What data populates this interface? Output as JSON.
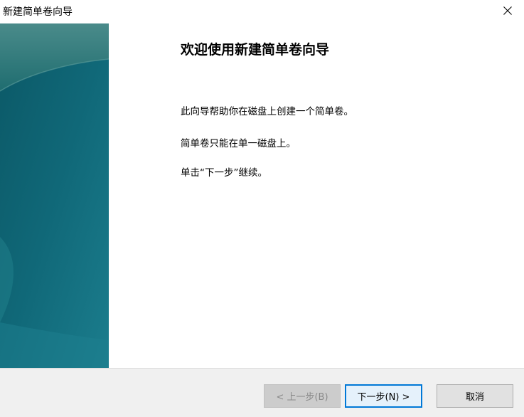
{
  "window": {
    "title": "新建简单卷向导",
    "close_icon": "close-icon"
  },
  "content": {
    "heading": "欢迎使用新建简单卷向导",
    "paragraphs": [
      "此向导帮助你在磁盘上创建一个简单卷。",
      "简单卷只能在单一磁盘上。",
      "单击“下一步”继续。"
    ]
  },
  "footer": {
    "back_label": "< 上一步(B)",
    "next_label": "下一步(N) >",
    "cancel_label": "取消"
  },
  "colors": {
    "accent": "#0078d7",
    "side_panel_dark": "#0e5f6a",
    "side_panel_light": "#1a7b8a"
  }
}
